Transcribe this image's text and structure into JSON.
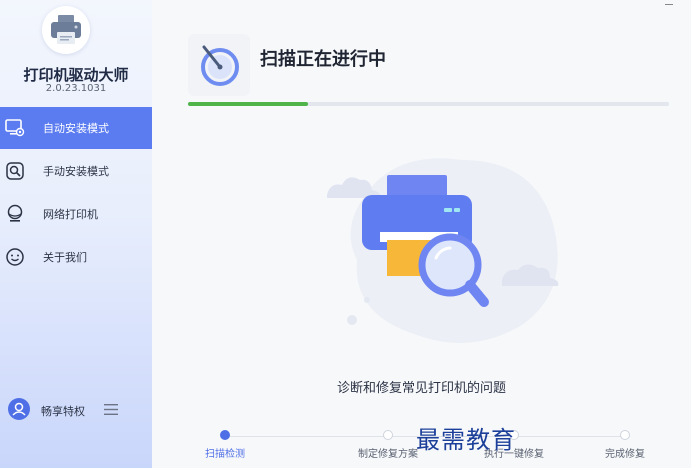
{
  "app": {
    "title": "打印机驱动大师",
    "version": "2.0.23.1031"
  },
  "sidebar": {
    "items": [
      {
        "label": "自动安装模式",
        "icon": "auto-install-icon",
        "active": true
      },
      {
        "label": "手动安装模式",
        "icon": "manual-install-icon",
        "active": false
      },
      {
        "label": "网络打印机",
        "icon": "network-printer-icon",
        "active": false
      },
      {
        "label": "关于我们",
        "icon": "about-icon",
        "active": false
      }
    ],
    "user": {
      "name": "畅享特权"
    }
  },
  "main": {
    "title": "扫描正在进行中",
    "progress": 0.25,
    "subtitle": "诊断和修复常见打印机的问题",
    "steps": [
      {
        "label": "扫描检测",
        "active": true
      },
      {
        "label": "制定修复方案",
        "active": false
      },
      {
        "label": "执行一键修复",
        "active": false
      },
      {
        "label": "完成修复",
        "active": false
      }
    ]
  },
  "watermark": "最需教育",
  "colors": {
    "accent": "#5b7cf0",
    "progress": "#4fb54b",
    "text": "#1f2533"
  }
}
